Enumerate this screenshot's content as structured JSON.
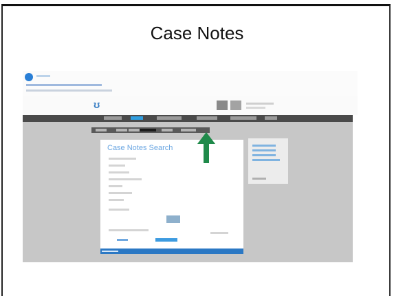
{
  "slide": {
    "title": "Case Notes"
  },
  "screenshot": {
    "dialog": {
      "title": "Case Notes Search"
    },
    "colors": {
      "nav_bar": "#4a4a4a",
      "accent": "#2f9ee0",
      "arrow": "#1f8a4a",
      "page_bg": "#c7c7c7"
    },
    "icons": {
      "arrow": "arrow-up-icon",
      "browser": "browser-logo-icon"
    }
  }
}
